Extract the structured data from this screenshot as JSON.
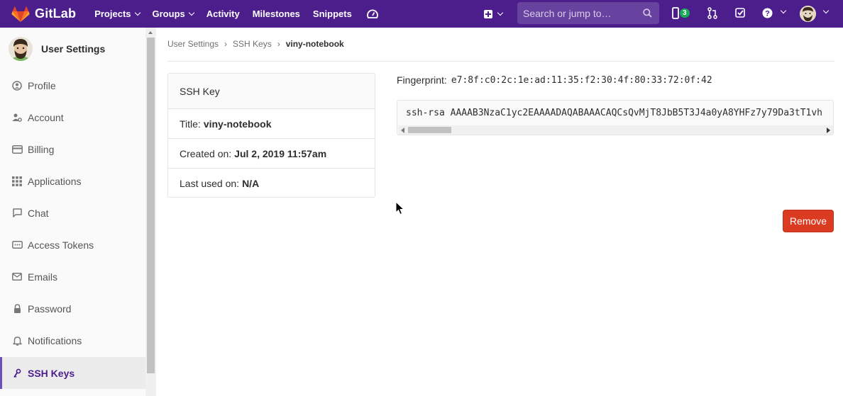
{
  "navbar": {
    "brand": "GitLab",
    "links": [
      {
        "label": "Projects",
        "dropdown": true
      },
      {
        "label": "Groups",
        "dropdown": true
      },
      {
        "label": "Activity",
        "dropdown": false
      },
      {
        "label": "Milestones",
        "dropdown": false
      },
      {
        "label": "Snippets",
        "dropdown": false
      }
    ],
    "search_placeholder": "Search or jump to…",
    "issues_badge": "3",
    "colors": {
      "bar": "#4b1e8c",
      "badge": "#1aaa55"
    }
  },
  "sidebar": {
    "title": "User Settings",
    "items": [
      {
        "label": "Profile",
        "icon": "profile-icon"
      },
      {
        "label": "Account",
        "icon": "account-icon"
      },
      {
        "label": "Billing",
        "icon": "credit-card-icon"
      },
      {
        "label": "Applications",
        "icon": "applications-grid-icon"
      },
      {
        "label": "Chat",
        "icon": "comment-icon"
      },
      {
        "label": "Access Tokens",
        "icon": "token-icon"
      },
      {
        "label": "Emails",
        "icon": "mail-icon"
      },
      {
        "label": "Password",
        "icon": "lock-icon"
      },
      {
        "label": "Notifications",
        "icon": "notifications-bell-icon"
      },
      {
        "label": "SSH Keys",
        "icon": "key-icon",
        "active": true
      }
    ]
  },
  "breadcrumb": [
    "User Settings",
    "SSH Keys",
    "viny-notebook"
  ],
  "key_card": {
    "header": "SSH Key",
    "title_label": "Title:",
    "title_value": "viny-notebook",
    "created_label": "Created on:",
    "created_value": "Jul 2, 2019 11:57am",
    "last_used_label": "Last used on:",
    "last_used_value": "N/A"
  },
  "fingerprint": {
    "label": "Fingerprint:",
    "value": "e7:8f:c0:2c:1e:ad:11:35:f2:30:4f:80:33:72:0f:42"
  },
  "public_key": "ssh-rsa AAAAB3NzaC1yc2EAAAADAQABAAACAQCsQvMjT8JbB5T3J4a0yA8YHFz7y79Da3tT1vh",
  "remove_label": "Remove",
  "colors": {
    "danger": "#db3b21",
    "active_accent": "#6b4fbb"
  }
}
